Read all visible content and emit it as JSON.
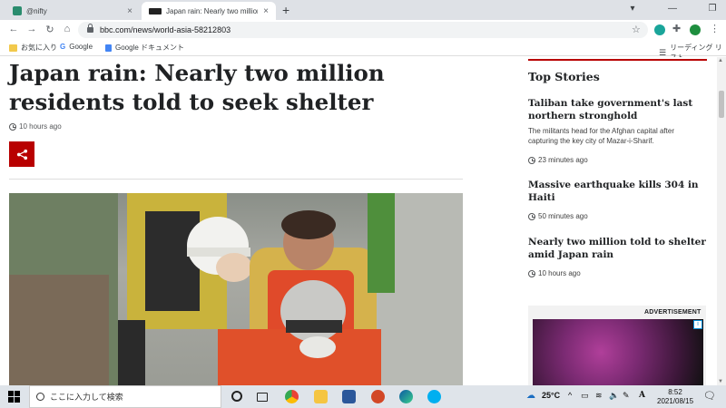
{
  "browser": {
    "tabs": [
      {
        "title": "@nifty",
        "close": "×"
      },
      {
        "title": "Japan rain: Nearly two million re",
        "close": "×"
      }
    ],
    "new_tab": "+",
    "url": "bbc.com/news/world-asia-58212803",
    "bookmarks": [
      "お気に入り",
      "Google",
      "Google ドキュメント"
    ],
    "reading_list": "リーディング リスト"
  },
  "article": {
    "headline": "Japan rain: Nearly two million residents told to seek shelter",
    "time": "10 hours ago"
  },
  "sidebar": {
    "heading": "Top Stories",
    "stories": [
      {
        "title": "Taliban take government's last northern stronghold",
        "summary": "The militants head for the Afghan capital after capturing the key city of Mazar-i-Sharif.",
        "time": "23 minutes ago"
      },
      {
        "title": "Massive earthquake kills 304 in Haiti",
        "summary": "",
        "time": "50 minutes ago"
      },
      {
        "title": "Nearly two million told to shelter amid Japan rain",
        "summary": "",
        "time": "10 hours ago"
      }
    ],
    "ad_label": "ADVERTISEMENT"
  },
  "taskbar": {
    "search_placeholder": "ここに入力して検索",
    "temperature": "25°C",
    "ime": "A",
    "time": "8:52",
    "date": "2021/08/15"
  },
  "colors": {
    "bbc_red": "#b80000",
    "taskbar": "#dfe4ea"
  }
}
